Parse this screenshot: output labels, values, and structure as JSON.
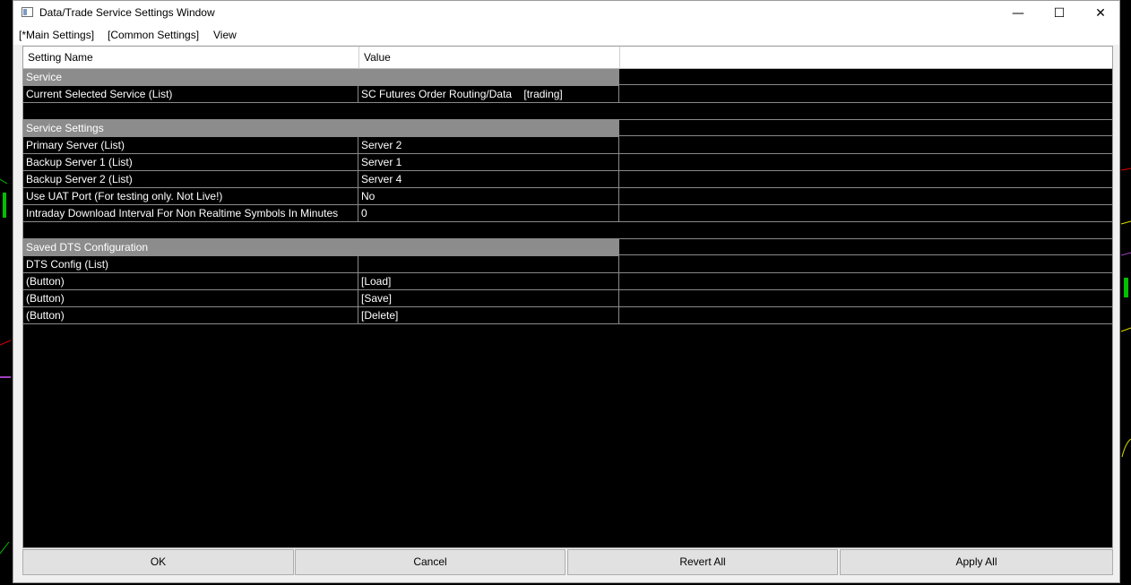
{
  "window": {
    "title": "Data/Trade Service Settings Window",
    "minimize_glyph": "—",
    "maximize_glyph": "☐",
    "close_glyph": "✕"
  },
  "menu": {
    "items": [
      "[*Main Settings]",
      "[Common Settings]",
      "View"
    ]
  },
  "grid": {
    "headers": [
      "Setting Name",
      "Value"
    ],
    "sections": [
      {
        "title": "Service",
        "rows": [
          {
            "name": "Current Selected Service (List)",
            "value": "SC Futures Order Routing/Data    [trading]"
          }
        ]
      },
      {
        "title": "Service Settings",
        "rows": [
          {
            "name": "Primary Server (List)",
            "value": "Server 2"
          },
          {
            "name": "Backup Server 1 (List)",
            "value": "Server 1"
          },
          {
            "name": "Backup Server 2 (List)",
            "value": "Server 4"
          },
          {
            "name": "Use UAT Port (For testing only. Not Live!)",
            "value": "No"
          },
          {
            "name": "Intraday Download Interval For Non Realtime Symbols In Minutes",
            "value": "0"
          }
        ]
      },
      {
        "title": "Saved DTS Configuration",
        "rows": [
          {
            "name": "DTS Config (List)",
            "value": ""
          },
          {
            "name": "(Button)",
            "value": "[Load]"
          },
          {
            "name": "(Button)",
            "value": "[Save]"
          },
          {
            "name": "(Button)",
            "value": "[Delete]"
          }
        ]
      }
    ]
  },
  "footer": {
    "ok": "OK",
    "cancel": "Cancel",
    "revert_all": "Revert All",
    "apply_all": "Apply All"
  },
  "colors": {
    "section_bg": "#8c8c8c",
    "grid_bg": "#000000",
    "chart_green": "#00c000",
    "chart_red": "#e00000"
  }
}
